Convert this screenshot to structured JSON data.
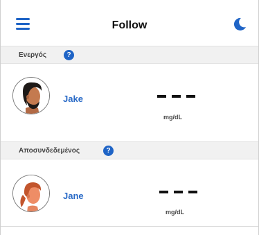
{
  "header": {
    "title": "Follow",
    "menu_icon": "hamburger-menu-icon",
    "theme_icon": "moon-icon",
    "accent": "#1f64c6"
  },
  "sections": [
    {
      "label": "Ενεργός",
      "help": "?",
      "entries": [
        {
          "name": "Jake",
          "glucose": "– – –",
          "unit": "mg/dL"
        }
      ]
    },
    {
      "label": "Αποσυνδεδεμένος",
      "help": "?",
      "entries": [
        {
          "name": "Jane",
          "glucose": "– – –",
          "unit": "mg/dL"
        }
      ]
    }
  ]
}
